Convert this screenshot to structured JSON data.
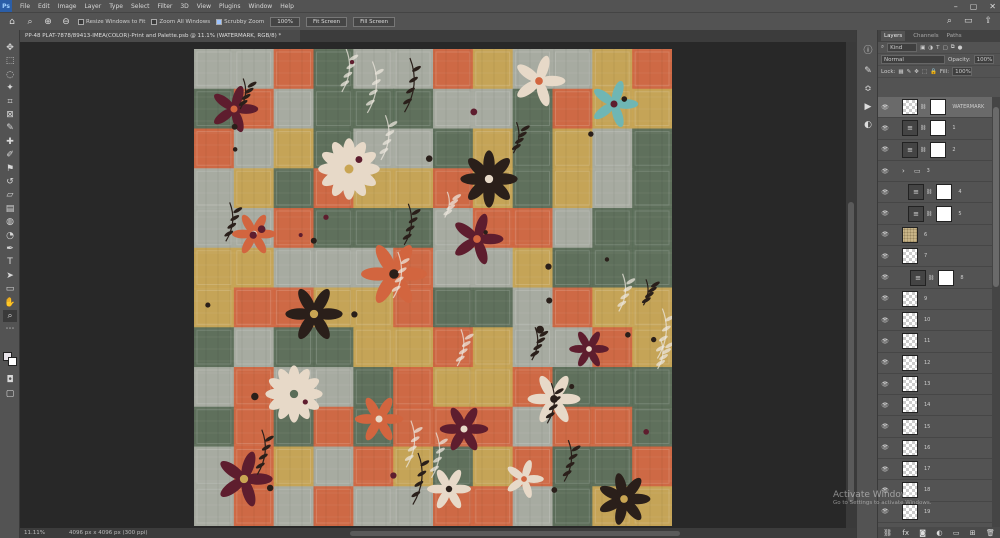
{
  "menubar": {
    "logo": "Ps",
    "items": [
      "File",
      "Edit",
      "Image",
      "Layer",
      "Type",
      "Select",
      "Filter",
      "3D",
      "View",
      "Plugins",
      "Window",
      "Help"
    ],
    "window_controls": [
      "–",
      "▢",
      "✕"
    ]
  },
  "options": {
    "resize_windows_label": "Resize Windows to Fit",
    "zoom_all_label": "Zoom All Windows",
    "scrubby_zoom_label": "Scrubby Zoom",
    "zoom_value": "100%",
    "fit_screen_label": "Fit Screen",
    "fill_screen_label": "Fill Screen"
  },
  "document": {
    "tab_title": "PP-48 PLAT-7878/89413-IMEA(COLOR)-Print and Palette.psb @ 11.1% (WATERMARK, RGB/8) *"
  },
  "status": {
    "zoom": "11.11%",
    "doc_size": "4096 px x 4096 px (300 ppi)"
  },
  "layers_panel": {
    "tabs": [
      "Layers",
      "Channels",
      "Paths"
    ],
    "filter_label": "Kind",
    "blend_mode": "Normal",
    "opacity_label": "Opacity:",
    "opacity_value": "100%",
    "lock_label": "Lock:",
    "fill_label": "Fill:",
    "fill_value": "100%",
    "layers": [
      {
        "name": "WATERMARK",
        "type": "pixel-mask",
        "selected": true
      },
      {
        "name": "1",
        "type": "adj-mask"
      },
      {
        "name": "2",
        "type": "adj-mask"
      },
      {
        "name": "3",
        "type": "group"
      },
      {
        "name": "4",
        "type": "adj-mask-indent"
      },
      {
        "name": "5",
        "type": "adj-mask-indent"
      },
      {
        "name": "6",
        "type": "texture"
      },
      {
        "name": "7",
        "type": "empty"
      },
      {
        "name": "8",
        "type": "adj-mask-linked"
      },
      {
        "name": "9",
        "type": "empty"
      },
      {
        "name": "10",
        "type": "empty"
      },
      {
        "name": "11",
        "type": "empty"
      },
      {
        "name": "12",
        "type": "empty"
      },
      {
        "name": "13",
        "type": "empty"
      },
      {
        "name": "14",
        "type": "empty"
      },
      {
        "name": "15",
        "type": "empty"
      },
      {
        "name": "16",
        "type": "empty"
      },
      {
        "name": "17",
        "type": "empty"
      },
      {
        "name": "18",
        "type": "empty"
      },
      {
        "name": "19",
        "type": "empty"
      }
    ]
  },
  "windows_watermark": {
    "title": "Activate Windows",
    "subtitle": "Go to Settings to activate Windows."
  },
  "artwork": {
    "palette": [
      "#d2653f",
      "#5a6d58",
      "#c9a553",
      "#a8ada3",
      "#5e1d2e",
      "#2a1f1a",
      "#e7d9c8",
      "#6fb6b4"
    ]
  }
}
